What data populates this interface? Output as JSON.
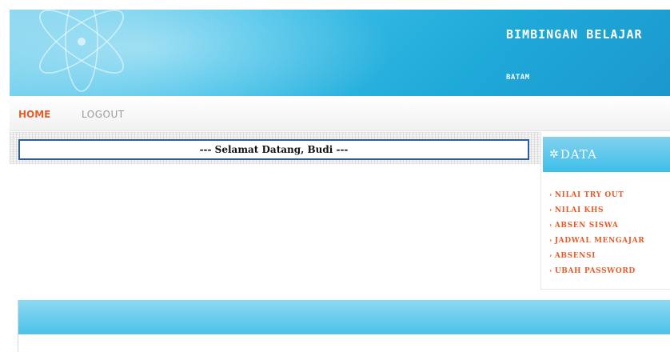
{
  "header": {
    "title": "BIMBINGAN BELAJAR",
    "subtitle": "BATAM",
    "logo_icon": "atom-icon"
  },
  "nav": {
    "home": "HOME",
    "logout": "LOGOUT",
    "active_color": "#e45d2c"
  },
  "welcome": {
    "text": "--- Selamat Datang, Budi ---"
  },
  "sidebar": {
    "header_icon": "asterisk-icon",
    "title": "DATA",
    "items": [
      {
        "label": "NILAI TRY OUT"
      },
      {
        "label": "NILAI KHS"
      },
      {
        "label": "ABSEN SISWA"
      },
      {
        "label": "JADWAL MENGAJAR"
      },
      {
        "label": "ABSENSI"
      },
      {
        "label": "UBAH PASSWORD"
      }
    ]
  },
  "colors": {
    "banner": "#1ea9d8",
    "accent": "#e45d2c",
    "welcome_border": "#2a5e9e"
  }
}
